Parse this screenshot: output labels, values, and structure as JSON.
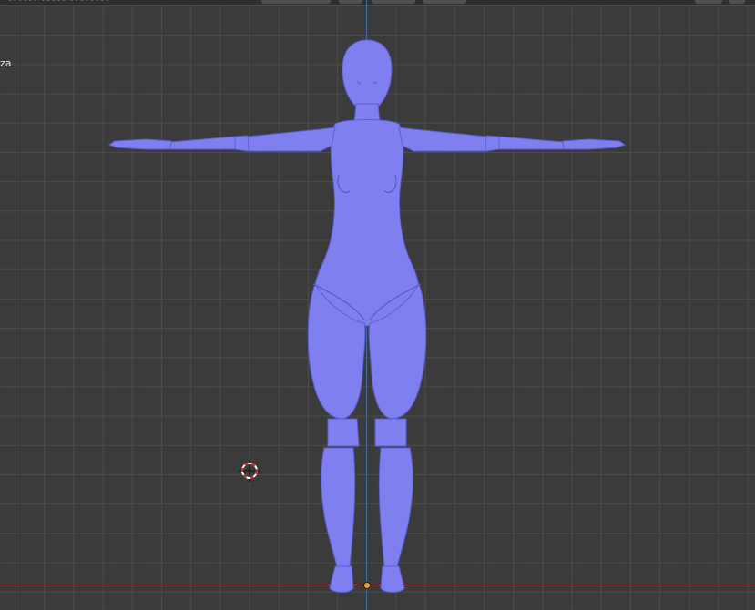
{
  "viewport": {
    "view_label": "za",
    "header_fragments": [
      "∙∙∙∙∙∙ ∙∙∙∙∙ ∙∙∙∙∙∙∙∙"
    ],
    "colors": {
      "background": "#3b3b3b",
      "grid": "#4e4e4e",
      "x_axis": "#b04a52",
      "z_axis": "#3f6fa0",
      "mesh": "#7f7ff0",
      "mesh_shade": "#5d5dd6",
      "origin": "#f0a030"
    }
  },
  "scene": {
    "object": "humanoid-mesh",
    "cursor": "3d-cursor-icon",
    "origin": "origin-dot"
  }
}
